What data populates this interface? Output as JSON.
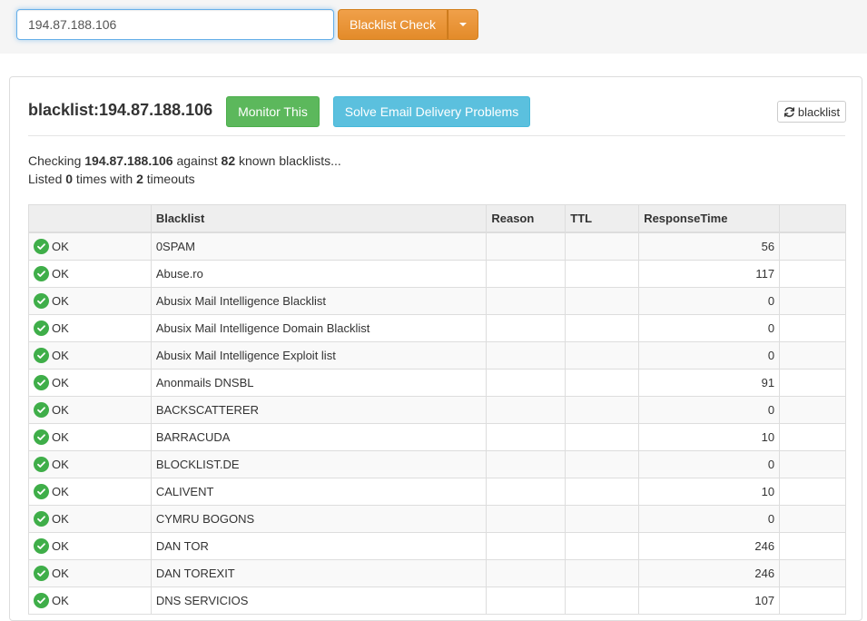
{
  "search": {
    "value": "194.87.188.106",
    "button_label": "Blacklist Check"
  },
  "panel": {
    "title": "blacklist:194.87.188.106",
    "monitor_label": "Monitor This",
    "solve_label": "Solve Email Delivery Problems",
    "refresh_label": "blacklist"
  },
  "summary": {
    "checking_prefix": "Checking ",
    "ip": "194.87.188.106",
    "against": " against ",
    "count": "82",
    "known": " known blacklists...",
    "listed_prefix": "Listed ",
    "listed_count": "0",
    "times_with": " times with ",
    "timeouts_count": "2",
    "timeouts": " timeouts"
  },
  "table": {
    "headers": [
      "",
      "Blacklist",
      "Reason",
      "TTL",
      "ResponseTime",
      ""
    ],
    "rows": [
      {
        "status": "OK",
        "name": "0SPAM",
        "reason": "",
        "ttl": "",
        "time": "56"
      },
      {
        "status": "OK",
        "name": "Abuse.ro",
        "reason": "",
        "ttl": "",
        "time": "117"
      },
      {
        "status": "OK",
        "name": "Abusix Mail Intelligence Blacklist",
        "reason": "",
        "ttl": "",
        "time": "0"
      },
      {
        "status": "OK",
        "name": "Abusix Mail Intelligence Domain Blacklist",
        "reason": "",
        "ttl": "",
        "time": "0"
      },
      {
        "status": "OK",
        "name": "Abusix Mail Intelligence Exploit list",
        "reason": "",
        "ttl": "",
        "time": "0"
      },
      {
        "status": "OK",
        "name": "Anonmails DNSBL",
        "reason": "",
        "ttl": "",
        "time": "91"
      },
      {
        "status": "OK",
        "name": "BACKSCATTERER",
        "reason": "",
        "ttl": "",
        "time": "0"
      },
      {
        "status": "OK",
        "name": "BARRACUDA",
        "reason": "",
        "ttl": "",
        "time": "10"
      },
      {
        "status": "OK",
        "name": "BLOCKLIST.DE",
        "reason": "",
        "ttl": "",
        "time": "0"
      },
      {
        "status": "OK",
        "name": "CALIVENT",
        "reason": "",
        "ttl": "",
        "time": "10"
      },
      {
        "status": "OK",
        "name": "CYMRU BOGONS",
        "reason": "",
        "ttl": "",
        "time": "0"
      },
      {
        "status": "OK",
        "name": "DAN TOR",
        "reason": "",
        "ttl": "",
        "time": "246"
      },
      {
        "status": "OK",
        "name": "DAN TOREXIT",
        "reason": "",
        "ttl": "",
        "time": "246"
      },
      {
        "status": "OK",
        "name": "DNS SERVICIOS",
        "reason": "",
        "ttl": "",
        "time": "107"
      }
    ]
  },
  "colors": {
    "ok_green": "#3fae49",
    "orange": "#e38b2a",
    "green": "#5cb85c",
    "blue": "#5bc0de"
  },
  "icons": {
    "status": "check-circle-icon",
    "refresh": "refresh-icon",
    "dropdown": "caret-down-icon"
  }
}
